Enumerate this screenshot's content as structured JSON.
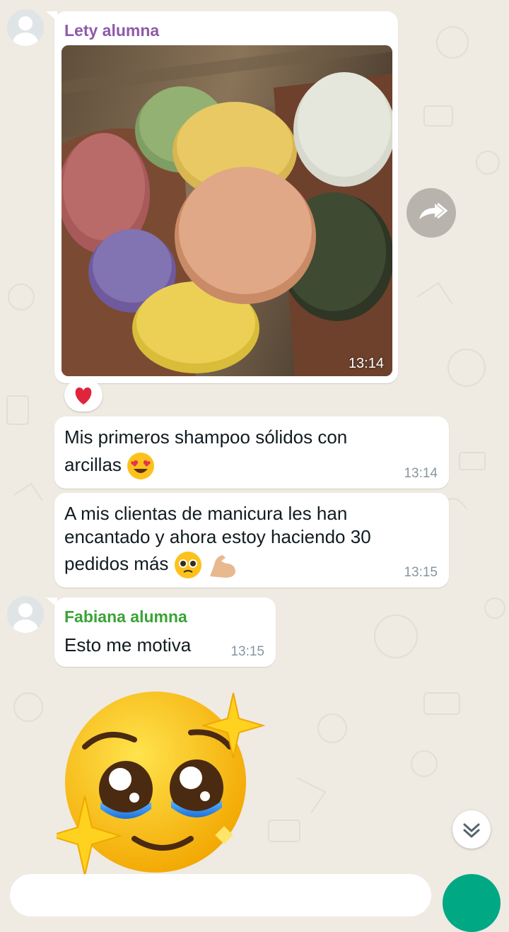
{
  "messages": [
    {
      "sender": "Lety alumna",
      "sender_color": "#8e5aa8",
      "photo_time": "13:14",
      "reaction": "red-heart"
    },
    {
      "text_line1": "Mis primeros shampoo sólidos con",
      "text_line2": "arcillas",
      "emoji": "heart-eyes-emoji",
      "time": "13:14"
    },
    {
      "text_line1": "A mis clientas de manicura les han",
      "text_line2": "encantado y ahora estoy haciendo 30",
      "text_line3": "pedidos más",
      "emoji": [
        "pleading-face-emoji",
        "flexed-biceps-emoji"
      ],
      "time": "13:15"
    },
    {
      "sender": "Fabiana alumna",
      "sender_color": "#3aa335",
      "text": "Esto me motiva",
      "time": "13:15"
    }
  ],
  "sticker": "pleading-face-sparkles-sticker",
  "colors": {
    "background": "#efeae2",
    "bubble": "#ffffff",
    "accent": "#00a884"
  }
}
